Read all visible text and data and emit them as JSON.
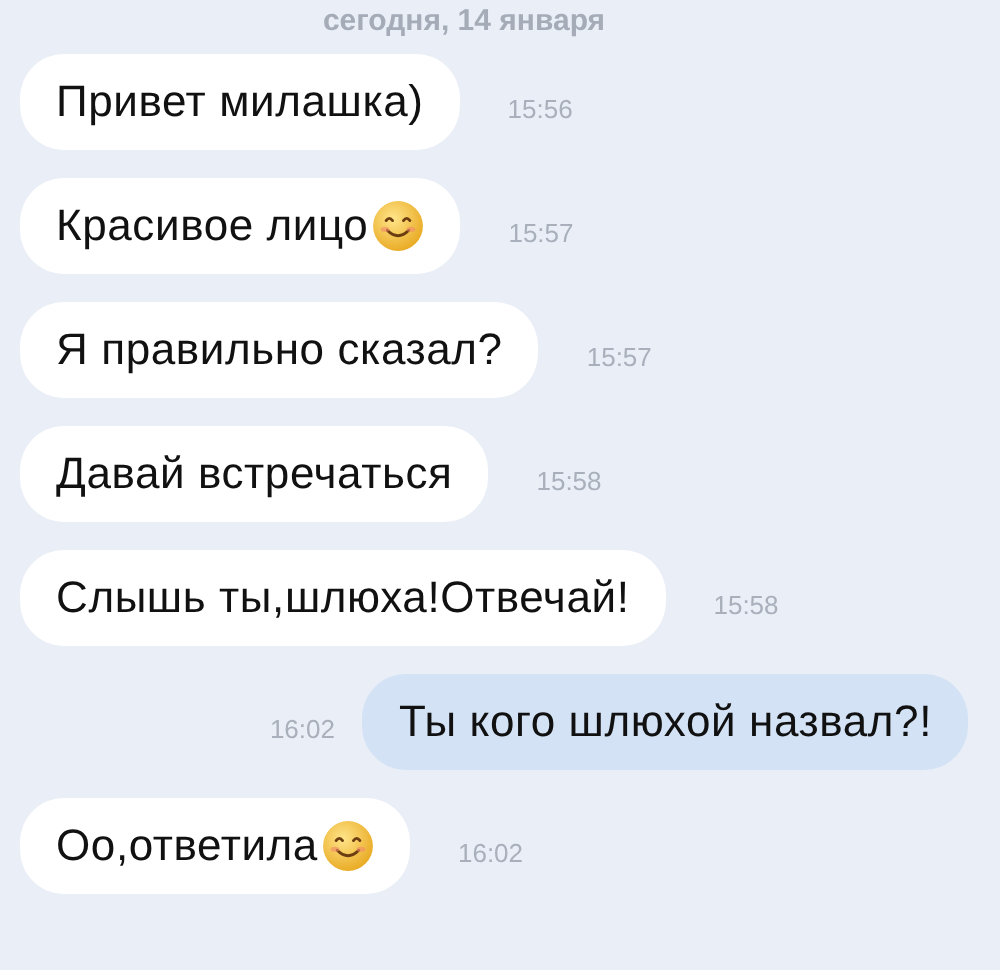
{
  "date_header": "сегодня, 14 января",
  "messages": [
    {
      "kind": "received",
      "text": "Привет милашка)",
      "emoji": false,
      "time": "15:56"
    },
    {
      "kind": "received",
      "text": "Красивое лицо",
      "emoji": true,
      "time": "15:57"
    },
    {
      "kind": "received",
      "text": "Я правильно сказал?",
      "emoji": false,
      "time": "15:57"
    },
    {
      "kind": "received",
      "text": "Давай встречаться",
      "emoji": false,
      "time": "15:58"
    },
    {
      "kind": "received",
      "text": "Слышь ты,шлюха!Отвечай!",
      "emoji": false,
      "time": "15:58"
    },
    {
      "kind": "sent",
      "text": "Ты кого шлюхой назвал?!",
      "emoji": false,
      "time": "16:02"
    },
    {
      "kind": "received",
      "text": "Оо,ответила",
      "emoji": true,
      "time": "16:02"
    }
  ]
}
